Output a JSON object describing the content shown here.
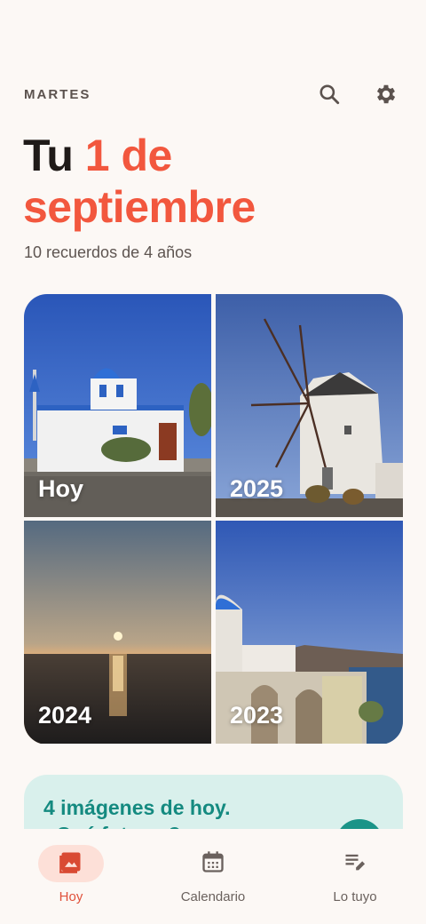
{
  "header": {
    "day": "MARTES",
    "icons": [
      "search-icon",
      "gear-icon"
    ]
  },
  "title": {
    "prefix": "Tu ",
    "accent_line1": "1 de",
    "accent_line2": "septiembre"
  },
  "subtitle": "10 recuerdos de 4 años",
  "tiles": [
    {
      "label": "Hoy",
      "scene": "whitewashed chapel with blue dome"
    },
    {
      "label": "2025",
      "scene": "white windmill"
    },
    {
      "label": "2024",
      "scene": "sunset over sea"
    },
    {
      "label": "2023",
      "scene": "blue dome village by sea"
    }
  ],
  "card": {
    "title": "4 imágenes de hoy.",
    "subtitle": "¿Qué foto es?"
  },
  "nav": {
    "items": [
      {
        "label": "Hoy",
        "icon": "photo-icon",
        "active": true
      },
      {
        "label": "Calendario",
        "icon": "calendar-icon",
        "active": false
      },
      {
        "label": "Lo tuyo",
        "icon": "edit-list-icon",
        "active": false
      }
    ]
  },
  "colors": {
    "accent": "#f2573e",
    "background": "#fcf8f5",
    "teal": "#148a80"
  }
}
